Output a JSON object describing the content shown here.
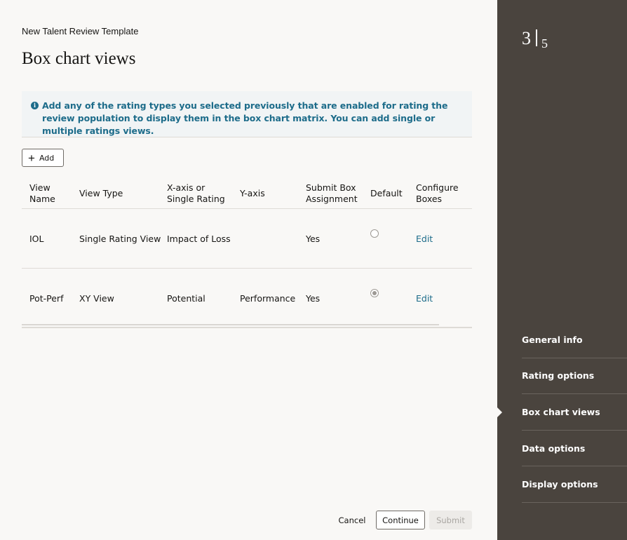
{
  "header": {
    "subtitle": "New Talent Review Template",
    "title": "Box chart views"
  },
  "info": {
    "icon": "info-icon",
    "text": "Add any of the rating types you selected previously that are enabled for rating the review population to display them in the box chart matrix. You can add single or multiple ratings views."
  },
  "toolbar": {
    "add_label": "Add"
  },
  "table": {
    "columns": [
      "View Name",
      "View Type",
      "X-axis or Single Rating",
      "Y-axis",
      "Submit Box Assignment",
      "Default",
      "Configure Boxes"
    ],
    "column_lines": [
      [
        "View",
        "Name"
      ],
      [
        "View Type"
      ],
      [
        "X-axis or",
        "Single Rating"
      ],
      [
        "Y-axis"
      ],
      [
        "Submit Box",
        "Assignment"
      ],
      [
        "Default"
      ],
      [
        "Configure",
        "Boxes"
      ]
    ],
    "rows": [
      {
        "name": "IOL",
        "type": "Single Rating View",
        "x_axis": "Impact of Loss",
        "y_axis": "",
        "submit": "Yes",
        "default": false,
        "configure": "Edit"
      },
      {
        "name": "Pot-Perf",
        "type": "XY View",
        "x_axis": "Potential",
        "y_axis": "Performance",
        "submit": "Yes",
        "default": true,
        "configure": "Edit"
      }
    ]
  },
  "footer": {
    "cancel": "Cancel",
    "continue": "Continue",
    "submit": "Submit"
  },
  "sidebar": {
    "current_step": "3",
    "total_steps": "5",
    "items": [
      {
        "label": "General info",
        "active": false
      },
      {
        "label": "Rating options",
        "active": false
      },
      {
        "label": "Box chart views",
        "active": true
      },
      {
        "label": "Data options",
        "active": false
      },
      {
        "label": "Display options",
        "active": false
      }
    ]
  }
}
